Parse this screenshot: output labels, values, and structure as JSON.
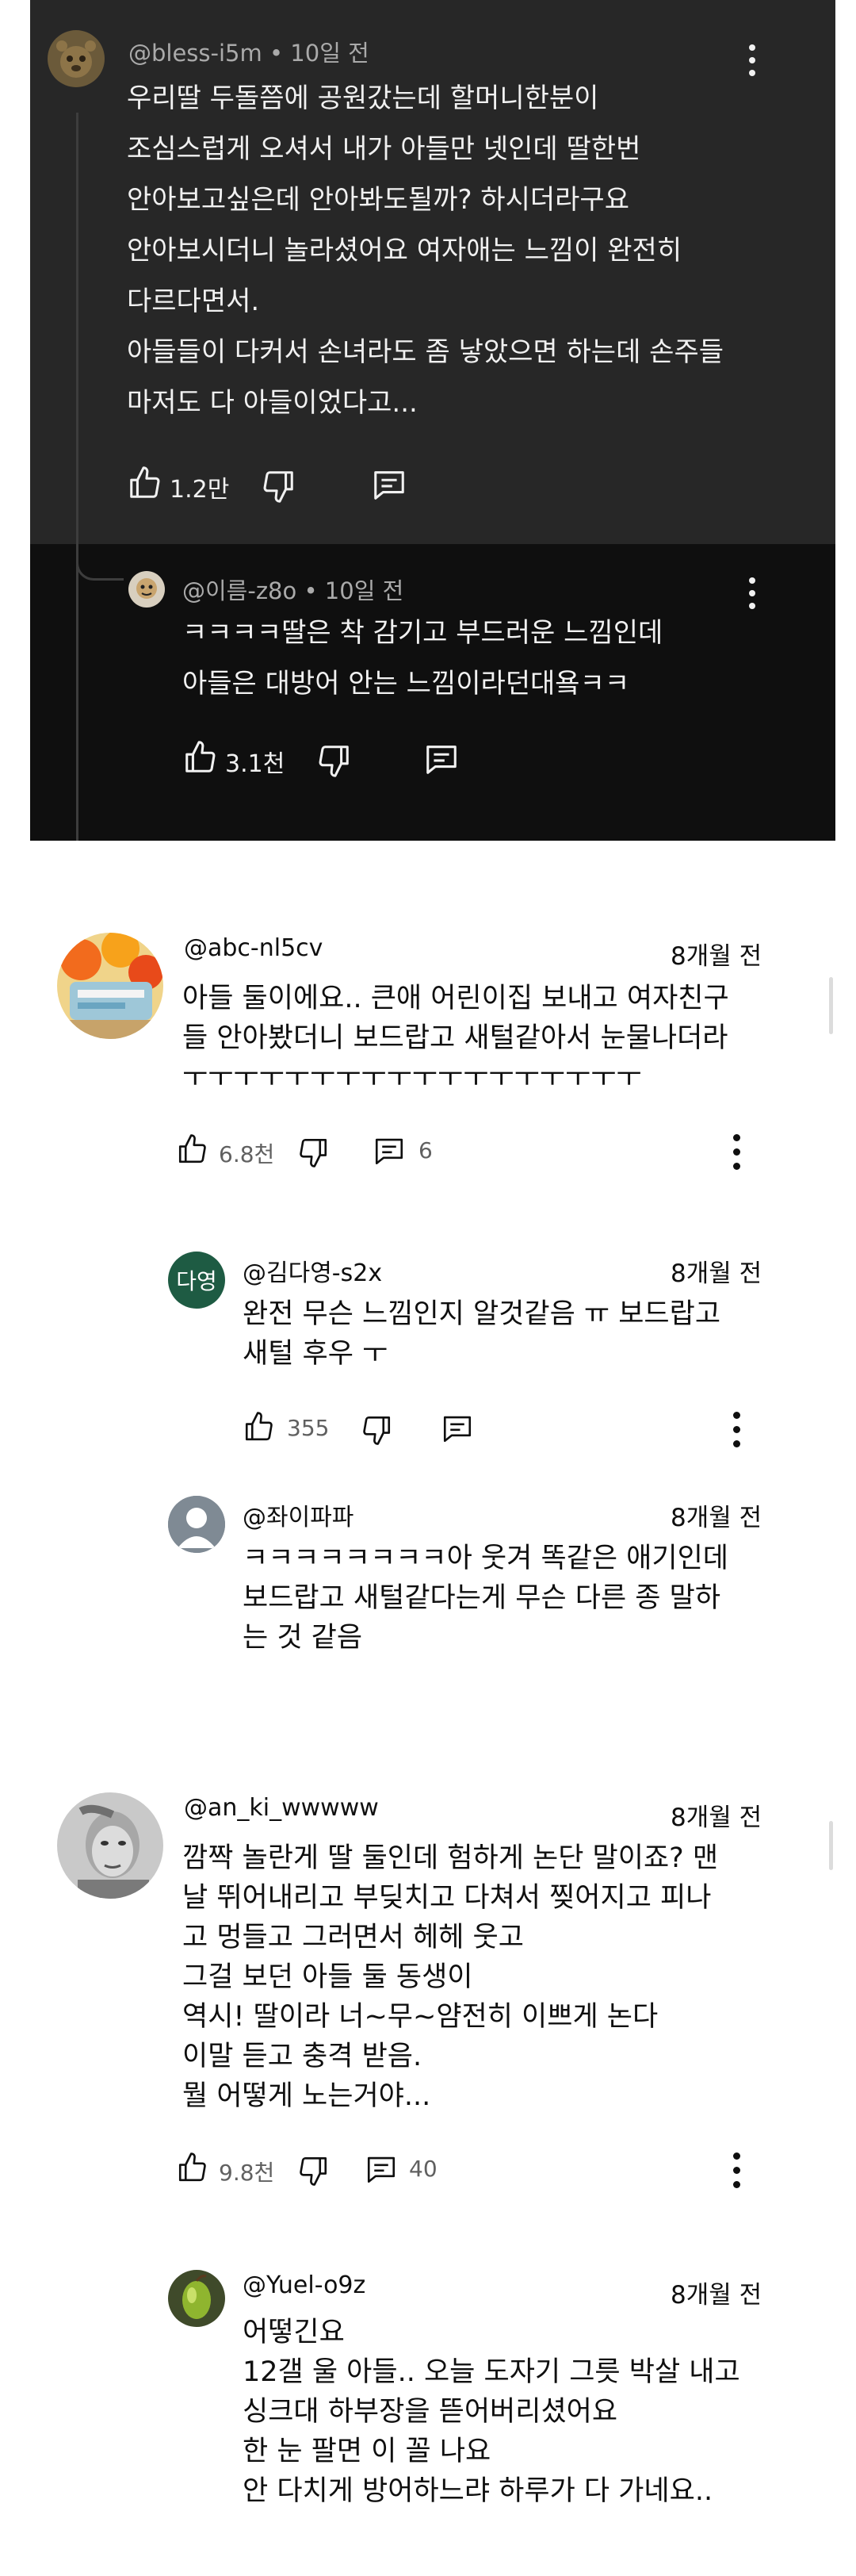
{
  "dark_thread": {
    "top_comment": {
      "handle": "@bless-i5m",
      "time": "10일 전",
      "lines": [
        "우리딸 두돌쯤에 공원갔는데 할머니한분이",
        "조심스럽게 오셔서 내가 아들만 넷인데 딸한번",
        "안아보고싶은데 안아봐도될까? 하시더라구요",
        "안아보시더니 놀라셨어요 여자애는 느낌이 완전히",
        "다르다면서.",
        "아들들이 다커서 손녀라도 좀 낳았으면 하는데 손주들",
        "마저도 다 아들이었다고..."
      ],
      "likes": "1.2만"
    },
    "reply": {
      "handle": "@이름-z8o",
      "time": "10일 전",
      "lines": [
        "ㅋㅋㅋㅋ딸은 착 감기고 부드러운 느낌인데",
        "아들은 대방어 안는 느낌이라던대욬ㅋㅋ"
      ],
      "likes": "3.1천"
    }
  },
  "comments": [
    {
      "handle": "@abc-nl5cv",
      "time": "8개월 전",
      "lines": [
        "아들 둘이에요.. 큰애 어린이집 보내고 여자친구",
        "들 안아봤더니 보드랍고 새털같아서 눈물나더라",
        "ㅜㅜㅜㅜㅜㅜㅜㅜㅜㅜㅜㅜㅜㅜㅜㅜㅜㅜ"
      ],
      "likes": "6.8천",
      "replies": "6"
    },
    {
      "handle": "@김다영-s2x",
      "avatar_initials": "다영",
      "avatar_color": "#1e5b43",
      "time": "8개월 전",
      "lines": [
        "완전 무슨 느낌인지 알것같음 ㅠ 보드랍고",
        "새털 후우 ㅜ"
      ],
      "likes": "355"
    },
    {
      "handle": "@좌이파파",
      "time": "8개월 전",
      "lines": [
        "ㅋㅋㅋㅋㅋㅋㅋㅋ아 웃겨 똑같은 애기인데",
        "보드랍고 새털같다는게 무슨 다른 종 말하",
        "는 것 같음"
      ]
    },
    {
      "handle": "@an_ki_wwwww",
      "time": "8개월 전",
      "lines": [
        "깜짝 놀란게 딸 둘인데 험하게 논단 말이죠? 맨",
        "날 뛰어내리고 부딪치고 다쳐서 찢어지고 피나",
        "고 멍들고 그러면서 헤헤 웃고",
        "그걸 보던 아들 둘 동생이",
        "역시! 딸이라 너~무~얌전히 이쁘게 논다",
        "이말 듣고 충격 받음.",
        "뭘 어떻게 노는거야..."
      ],
      "likes": "9.8천",
      "replies": "40"
    },
    {
      "handle": "@Yuel-o9z",
      "time": "8개월 전",
      "lines": [
        "어떻긴요",
        "12갤 울 아들.. 오늘 도자기 그릇 박살 내고",
        "싱크대 하부장을 뜯어버리셨어요",
        "한 눈 팔면 이 꼴 나요",
        "안 다치게 방어하느랴 하루가 다 가네요.."
      ]
    }
  ],
  "colors": {
    "dark_bg": "#0f0f0f",
    "dark_card": "#272727",
    "initials_avatar": "#1e5b43"
  },
  "icons": [
    "like-icon",
    "dislike-icon",
    "reply-icon",
    "more-icon"
  ]
}
